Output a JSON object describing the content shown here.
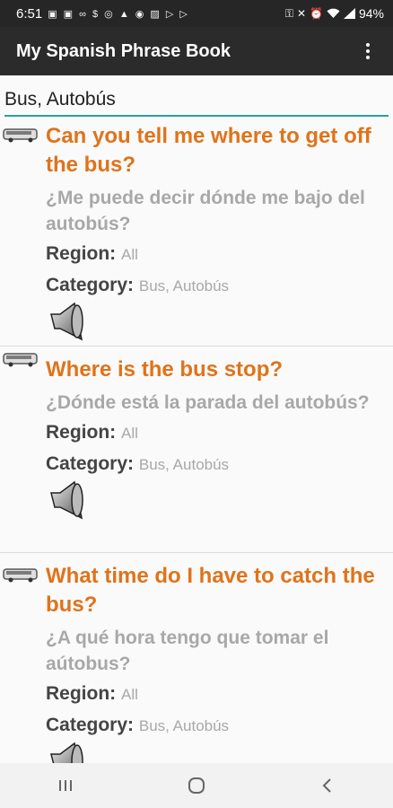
{
  "status_bar": {
    "time": "6:51",
    "left_icons": [
      "image-icon",
      "media-icon",
      "voicemail-icon",
      "dollar-icon",
      "instagram-icon",
      "lock-icon",
      "whatsapp-icon",
      "gallery-icon",
      "play-icon",
      "play-icon"
    ],
    "right_icons": [
      "key-icon",
      "mute-icon",
      "alarm-icon",
      "wifi-icon",
      "signal-icon"
    ],
    "battery": "94%"
  },
  "app_bar": {
    "title": "My Spanish Phrase Book",
    "overflow_icon": "more-vert-icon"
  },
  "search": {
    "value": "Bus, Autobús"
  },
  "phrases": [
    {
      "english": "Can you tell me where to get off the bus?",
      "spanish": "¿Me puede decir dónde me bajo del autobús?",
      "region_label": "Region:",
      "region": "All",
      "category_label": "Category:",
      "category": "Bus, Autobús"
    },
    {
      "english": "Where is the bus stop?",
      "spanish": "¿Dónde está la parada del autobús?",
      "region_label": "Region:",
      "region": "All",
      "category_label": "Category:",
      "category": "Bus, Autobús"
    },
    {
      "english": "What time do I have to catch the bus?",
      "spanish": "¿A qué hora tengo que tomar el aútobus?",
      "region_label": "Region:",
      "region": "All",
      "category_label": "Category:",
      "category": "Bus, Autobús"
    }
  ],
  "colors": {
    "accent": "#e0731a",
    "secondary_text": "#a8a8a8",
    "app_bar": "#2b2b2b",
    "underline": "#2aa198"
  },
  "nav_bar": {
    "icons": [
      "recent-apps-icon",
      "home-icon",
      "back-icon"
    ]
  }
}
